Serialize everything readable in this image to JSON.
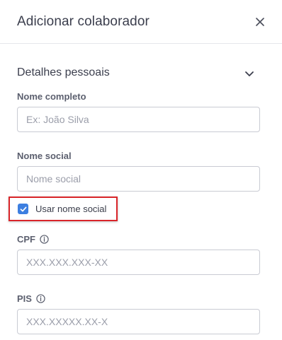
{
  "header": {
    "title": "Adicionar colaborador",
    "close_icon": "close-icon"
  },
  "section": {
    "title": "Detalhes pessoais",
    "chevron_icon": "chevron-down-icon"
  },
  "fields": {
    "full_name": {
      "label": "Nome completo",
      "placeholder": "Ex: João Silva",
      "value": ""
    },
    "social_name": {
      "label": "Nome social",
      "placeholder": "Nome social",
      "value": ""
    },
    "cpf": {
      "label": "CPF",
      "placeholder": "XXX.XXX.XXX-XX",
      "value": "",
      "info_icon": "info-icon"
    },
    "pis": {
      "label": "PIS",
      "placeholder": "XXX.XXXXX.XX-X",
      "value": "",
      "info_icon": "info-icon"
    }
  },
  "use_social_name": {
    "label": "Usar nome social",
    "checked": true
  },
  "colors": {
    "accent": "#3d7fe0",
    "highlight": "#d9252a"
  }
}
